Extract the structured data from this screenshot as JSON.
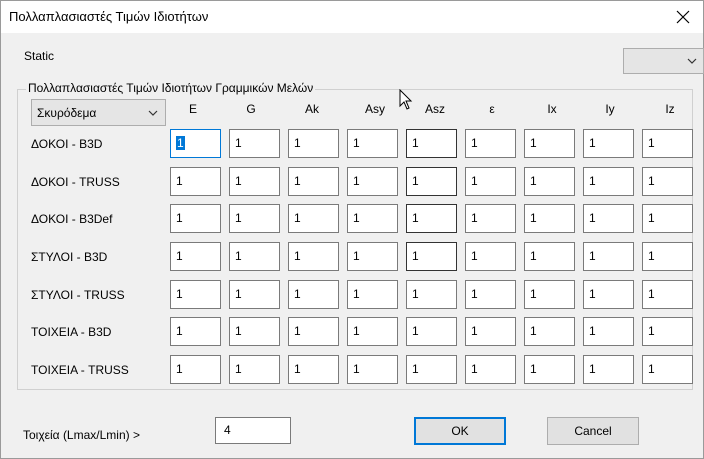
{
  "window": {
    "title": "Πολλαπλασιαστές Τιμών Ιδιοτήτων",
    "close_icon": "close-icon"
  },
  "static_label": "Static",
  "top_dropdown": {
    "value": ""
  },
  "group": {
    "legend": "Πολλαπλασιαστές Τιμών Ιδιοτήτων Γραμμικών Μελών",
    "material": "Σκυρόδεμα",
    "columns": [
      "E",
      "G",
      "Ak",
      "Asy",
      "Asz",
      "ε",
      "Ix",
      "Iy",
      "Iz"
    ],
    "rows": [
      {
        "label": "ΔΟΚΟΙ - B3D",
        "values": [
          "1",
          "1",
          "1",
          "1",
          "1",
          "1",
          "1",
          "1",
          "1"
        ]
      },
      {
        "label": "ΔΟΚΟΙ - TRUSS",
        "values": [
          "1",
          "1",
          "1",
          "1",
          "1",
          "1",
          "1",
          "1",
          "1"
        ]
      },
      {
        "label": "ΔΟΚΟΙ - B3Def",
        "values": [
          "1",
          "1",
          "1",
          "1",
          "1",
          "1",
          "1",
          "1",
          "1"
        ]
      },
      {
        "label": "ΣΤΥΛΟΙ - B3D",
        "values": [
          "1",
          "1",
          "1",
          "1",
          "1",
          "1",
          "1",
          "1",
          "1"
        ]
      },
      {
        "label": "ΣΤΥΛΟΙ - TRUSS",
        "values": [
          "1",
          "1",
          "1",
          "1",
          "1",
          "1",
          "1",
          "1",
          "1"
        ]
      },
      {
        "label": "ΤΟΙΧΕΙΑ - B3D",
        "values": [
          "1",
          "1",
          "1",
          "1",
          "1",
          "1",
          "1",
          "1",
          "1"
        ]
      },
      {
        "label": "ΤΟΙΧΕΙΑ - TRUSS",
        "values": [
          "1",
          "1",
          "1",
          "1",
          "1",
          "1",
          "1",
          "1",
          "1"
        ]
      }
    ]
  },
  "ratio": {
    "label": "Τοιχεία (Lmax/Lmin) >",
    "value": "4"
  },
  "buttons": {
    "ok": "OK",
    "cancel": "Cancel"
  }
}
